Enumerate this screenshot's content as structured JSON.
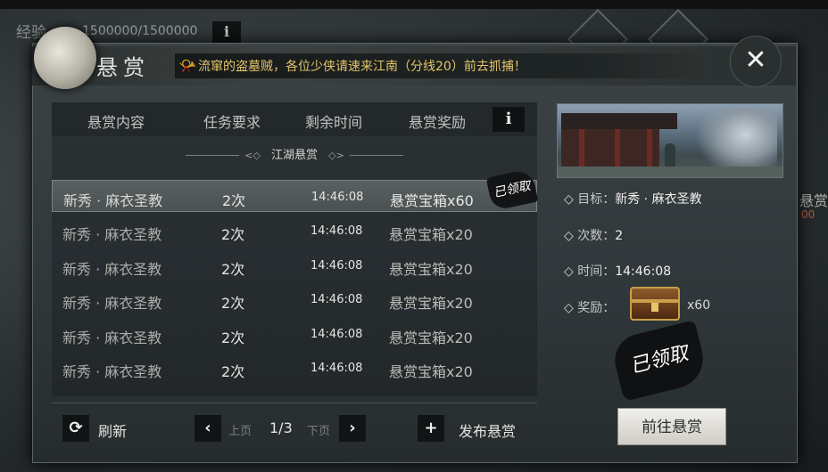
{
  "header": {
    "exp_label": "经验",
    "exp_value": "1500000/1500000",
    "exp_info_label": "i",
    "title": "悬赏",
    "notice_icon": "horn-icon",
    "notice": "流窜的盗墓贼，各位少侠请速来江南（分线20）前去抓捕！",
    "close_label": "✕"
  },
  "table": {
    "columns": [
      "悬赏内容",
      "任务要求",
      "剩余时间",
      "悬赏奖励"
    ],
    "info_label": "i",
    "section_title": "江湖悬赏",
    "section_left_deco": "<◇",
    "section_right_deco": "◇>",
    "rows": [
      {
        "name": "新秀 · 麻衣圣教",
        "count": "2次",
        "time": "14:46:08",
        "reward": "悬赏宝箱x60",
        "selected": true,
        "claimed": true
      },
      {
        "name": "新秀 · 麻衣圣教",
        "count": "2次",
        "time": "14:46:08",
        "reward": "悬赏宝箱x20"
      },
      {
        "name": "新秀 · 麻衣圣教",
        "count": "2次",
        "time": "14:46:08",
        "reward": "悬赏宝箱x20"
      },
      {
        "name": "新秀 · 麻衣圣教",
        "count": "2次",
        "time": "14:46:08",
        "reward": "悬赏宝箱x20"
      },
      {
        "name": "新秀 · 麻衣圣教",
        "count": "2次",
        "time": "14:46:08",
        "reward": "悬赏宝箱x20"
      },
      {
        "name": "新秀 · 麻衣圣教",
        "count": "2次",
        "time": "14:46:08",
        "reward": "悬赏宝箱x20"
      }
    ],
    "claimed_stamp": "已领取"
  },
  "footer": {
    "refresh_label": "刷新",
    "prev_label": "上页",
    "page": "1/3",
    "next_label": "下页",
    "publish_label": "发布悬赏"
  },
  "detail": {
    "target_label": "目标：",
    "target_value": "新秀 · 麻衣圣教",
    "count_label": "次数：",
    "count_value": "2",
    "time_label": "时间：",
    "time_value": "14:46:08",
    "reward_label": "奖励：",
    "reward_value": "x60",
    "claimed_stamp": "已领取",
    "go_button": "前往悬赏"
  },
  "edge": {
    "text": "悬赏",
    "number": "00"
  },
  "colors": {
    "notice_text": "#e4c56a",
    "panel": "#343b3d",
    "selected_row": "#545b5c"
  }
}
